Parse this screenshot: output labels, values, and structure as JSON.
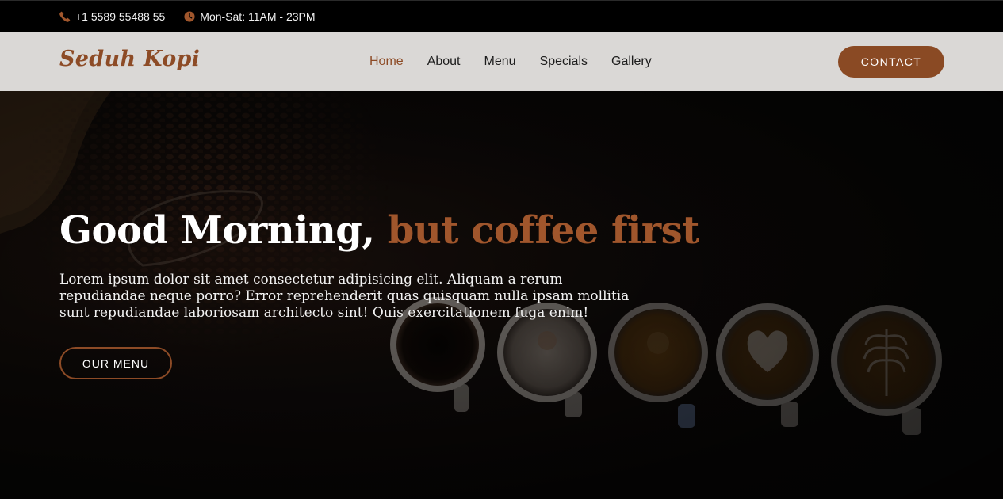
{
  "topbar": {
    "phone": "+1 5589 55488 55",
    "hours": "Mon-Sat: 11AM - 23PM"
  },
  "header": {
    "logo": "Seduh Kopi",
    "nav": [
      "Home",
      "About",
      "Menu",
      "Specials",
      "Gallery"
    ],
    "active_nav": "Home",
    "contact_label": "CONTACT"
  },
  "hero": {
    "headline_main": "Good Morning,",
    "headline_accent": "but coffee first",
    "description": "Lorem ipsum dolor sit amet consectetur adipisicing elit. Aliquam a rerum repudiandae neque porro? Error reprehenderit quas quisquam nulla ipsam mollitia sunt repudiandae laboriosam architecto sint! Quis exercitationem fuga enim!",
    "cta_label": "OUR MENU"
  },
  "colors": {
    "accent": "#8d4b26",
    "topbar_bg": "#000000",
    "header_bg": "#dad8d6"
  },
  "icons": {
    "phone": "phone-icon",
    "clock": "clock-icon"
  }
}
